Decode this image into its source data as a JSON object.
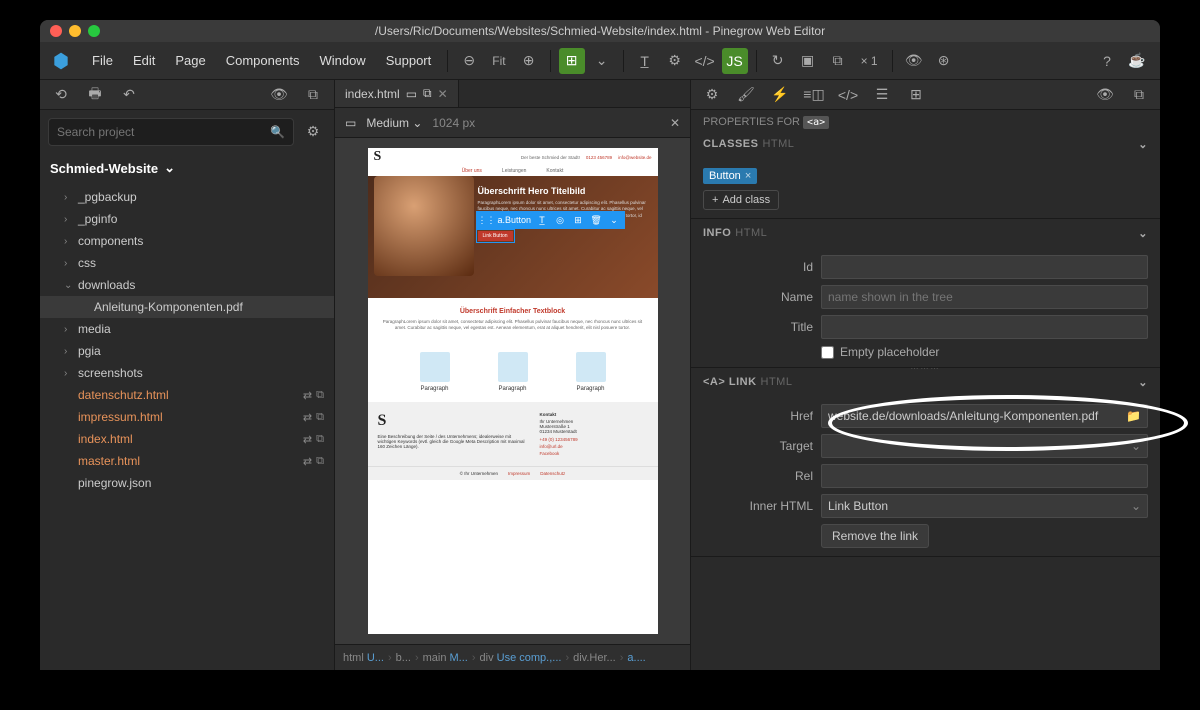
{
  "title": "/Users/Ric/Documents/Websites/Schmied-Website/index.html - Pinegrow Web Editor",
  "menu": {
    "file": "File",
    "edit": "Edit",
    "page": "Page",
    "components": "Components",
    "window": "Window",
    "support": "Support"
  },
  "toolbar": {
    "fit": "Fit",
    "zoom": "× 1"
  },
  "search": {
    "placeholder": "Search project"
  },
  "project": {
    "name": "Schmied-Website"
  },
  "tree": [
    {
      "label": "_pgbackup",
      "chev": "›",
      "indent": 1
    },
    {
      "label": "_pginfo",
      "chev": "›",
      "indent": 1
    },
    {
      "label": "components",
      "chev": "›",
      "indent": 1
    },
    {
      "label": "css",
      "chev": "›",
      "indent": 1
    },
    {
      "label": "downloads",
      "chev": "⌄",
      "indent": 1
    },
    {
      "label": "Anleitung-Komponenten.pdf",
      "chev": "",
      "indent": 2,
      "selected": true
    },
    {
      "label": "media",
      "chev": "›",
      "indent": 1
    },
    {
      "label": "pgia",
      "chev": "›",
      "indent": 1
    },
    {
      "label": "screenshots",
      "chev": "›",
      "indent": 1
    },
    {
      "label": "datenschutz.html",
      "chev": "",
      "indent": 1,
      "orange": true,
      "actions": true
    },
    {
      "label": "impressum.html",
      "chev": "",
      "indent": 1,
      "orange": true,
      "actions": true
    },
    {
      "label": "index.html",
      "chev": "",
      "indent": 1,
      "orange": true,
      "actions": true
    },
    {
      "label": "master.html",
      "chev": "",
      "indent": 1,
      "orange": true,
      "actions": true
    },
    {
      "label": "pinegrow.json",
      "chev": "",
      "indent": 1
    }
  ],
  "tab": {
    "name": "index.html"
  },
  "viewport": {
    "size": "Medium",
    "px": "1024 px"
  },
  "preview": {
    "tagline": "Der beste Schmied der Stadt!",
    "phone": "0123 456789",
    "email": "info@website.de",
    "nav1": "Über uns",
    "nav2": "Leistungen",
    "nav3": "Kontakt",
    "heroTitle": "Überschrift Hero Titelbild",
    "heroPara": "ParagraphLorem ipsum dolor sit amet, consectetur adipiscing elit. Phasellus pulvinar faucibus neque, nec rhoncus nunc ultrices sit amet. Curabitur ac sagittis neque, vel egestas est. Aenean elementum, erat at aliquet hendrerit, elit nisl posuere tortor, id suscipit diam dui sed nisi.",
    "selectionLabel": "a.Button",
    "linkButtonLabel": "Link Button",
    "section2Title": "Überschrift Einfacher Textblock",
    "section2Para": "ParagraphLorem ipsum dolor sit amet, consectetur adipiscing elit. Phasellus pulvinar faucibus neque, nec rhoncus nunc ultrices sit amet. Curabitur ac sagittis neque, vel egestas est. Aenean elementum, erat at aliquet hendrerit, elit nisl posuere tortor.",
    "cardLabel": "Paragraph",
    "footerTitleKontakt": "Kontakt",
    "footerDesc": "Eine Beschreibung der Seite / des Unternehmens; idealerweise mit wichtigen Keywords (evtl. gleich die Google Meta Description mit maximal 160 Zeichen Länge).",
    "footerCompany": "Ihr Unternehmen\nMusterstraße 1\n01234 Musterstadt",
    "footerPhone": "+49 (0) 123456789",
    "footerEmail": "info@url.de",
    "footerFacebook": "Facebook",
    "copyright": "© Ihr Unternehmen",
    "footerImpressum": "Impressum",
    "footerDatenschutz": "Datenschutz"
  },
  "breadcrumb": {
    "b1": "html",
    "b1s": "U...",
    "b2": "b...",
    "b3": "main",
    "b3s": "M...",
    "b4": "div",
    "b4s": "Use comp.,...",
    "b5": "div.Her...",
    "b6": "a...."
  },
  "props": {
    "forLabel": "PROPERTIES FOR",
    "forTag": "<a>",
    "classesLabel": "CLASSES",
    "htmlSub": "HTML",
    "classTag": "Button",
    "addClass": "Add class",
    "infoLabel": "INFO",
    "idLabel": "Id",
    "nameLabel": "Name",
    "namePlaceholder": "name shown in the tree",
    "titleLabel": "Title",
    "emptyPlaceholder": "Empty placeholder",
    "linkLabel": "<A> LINK",
    "hrefLabel": "Href",
    "hrefValue": "website.de/downloads/Anleitung-Komponenten.pdf",
    "targetLabel": "Target",
    "relLabel": "Rel",
    "innerHtmlLabel": "Inner HTML",
    "innerHtmlValue": "Link Button",
    "removeLink": "Remove the link"
  }
}
